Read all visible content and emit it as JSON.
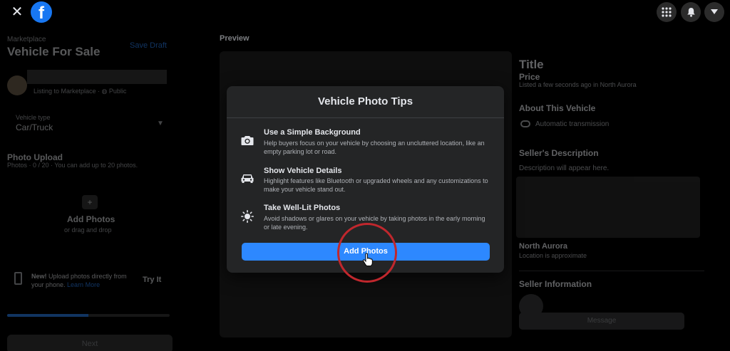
{
  "topbar": {
    "close_icon": "close-icon",
    "logo_letter": "f",
    "menu_icon": "grid-menu-icon",
    "notifications_icon": "bell-icon",
    "account_icon": "caret-down-icon",
    "brand_color": "#1877f2"
  },
  "left": {
    "breadcrumb": "Marketplace",
    "title": "Vehicle For Sale",
    "save_draft": "Save Draft",
    "listing_line": "Listing to Marketplace · ",
    "audience": "Public",
    "vehicle_type_label": "Vehicle type",
    "vehicle_type_value": "Car/Truck",
    "photo_upload_title": "Photo Upload",
    "photo_upload_sub": "Photos · 0 / 20 · You can add up to 20 photos.",
    "add_photos": "Add Photos",
    "drag_drop": "or drag and drop",
    "new_label": "New!",
    "new_text": " Upload photos directly from your phone. ",
    "learn_more": "Learn More",
    "try_it": "Try It",
    "progress_fraction": 0.5,
    "next": "Next"
  },
  "preview": {
    "label": "Preview",
    "title": "Title",
    "price": "Price",
    "listed": "Listed a few seconds ago in North Aurora",
    "about_heading": "About This Vehicle",
    "transmission": "Automatic transmission",
    "seller_desc_heading": "Seller's Description",
    "desc_placeholder": "Description will appear here.",
    "location": "North Aurora",
    "location_sub": "Location is approximate",
    "seller_info": "Seller Information",
    "message_btn": "Message"
  },
  "modal": {
    "title": "Vehicle Photo Tips",
    "tips": [
      {
        "icon": "camera-icon",
        "title": "Use a Simple Background",
        "body": "Help buyers focus on your vehicle by choosing an uncluttered location, like an empty parking lot or road."
      },
      {
        "icon": "car-icon",
        "title": "Show Vehicle Details",
        "body": "Highlight features like Bluetooth or upgraded wheels and any customizations to make your vehicle stand out."
      },
      {
        "icon": "sun-icon",
        "title": "Take Well-Lit Photos",
        "body": "Avoid shadows or glares on your vehicle by taking photos in the early morning or late evening."
      }
    ],
    "add_photos": "Add Photos",
    "accent_color": "#2d88ff"
  },
  "annotation": {
    "circle_color": "#c0272d"
  }
}
